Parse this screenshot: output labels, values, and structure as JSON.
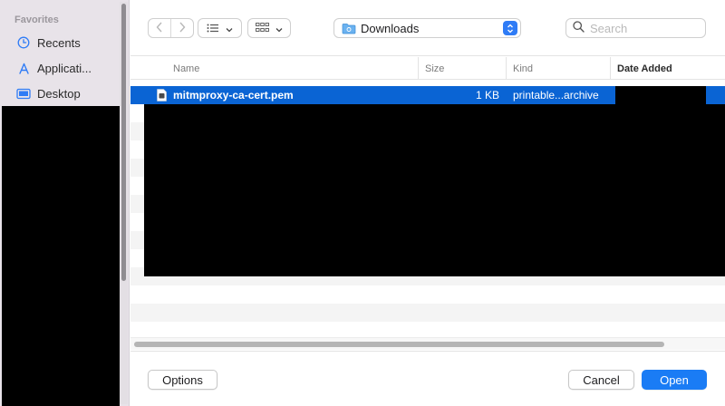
{
  "sidebar": {
    "heading": "Favorites",
    "items": [
      {
        "label": "Recents",
        "icon": "clock-icon"
      },
      {
        "label": "Applicati...",
        "icon": "applications-icon"
      },
      {
        "label": "Desktop",
        "icon": "desktop-icon"
      }
    ]
  },
  "toolbar": {
    "back_icon": "chevron-left-icon",
    "forward_icon": "chevron-right-icon",
    "list_view_icon": "list-view-icon",
    "grid_view_icon": "grid-view-icon",
    "location": "Downloads",
    "search_placeholder": "Search"
  },
  "columns": [
    "Name",
    "Size",
    "Kind",
    "Date Added"
  ],
  "files": [
    {
      "name": "mitmproxy-ca-cert.pem",
      "size": "1 KB",
      "kind": "printable...archive",
      "date_added": ""
    }
  ],
  "footer": {
    "options_label": "Options",
    "cancel_label": "Cancel",
    "open_label": "Open"
  },
  "colors": {
    "accent": "#0a64d4",
    "primary_button": "#1a7cf5",
    "sidebar_bg": "#e8e3e9"
  }
}
